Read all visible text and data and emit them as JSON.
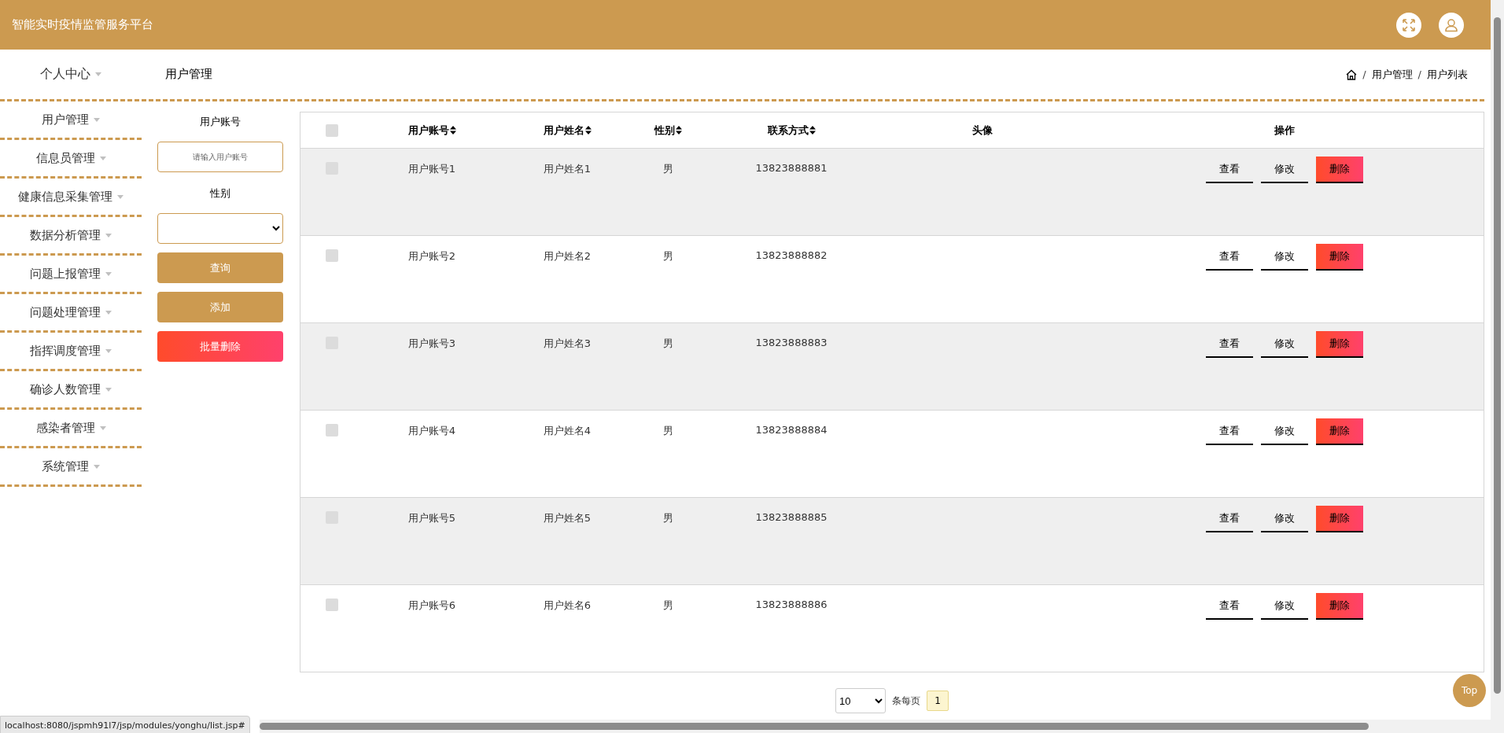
{
  "header": {
    "title": "智能实时疫情监管服务平台"
  },
  "sidebar": {
    "items": [
      {
        "label": "个人中心"
      },
      {
        "label": "用户管理"
      },
      {
        "label": "信息员管理"
      },
      {
        "label": "健康信息采集管理"
      },
      {
        "label": "数据分析管理"
      },
      {
        "label": "问题上报管理"
      },
      {
        "label": "问题处理管理"
      },
      {
        "label": "指挥调度管理"
      },
      {
        "label": "确诊人数管理"
      },
      {
        "label": "感染者管理"
      },
      {
        "label": "系统管理"
      }
    ]
  },
  "page_title": "用户管理",
  "breadcrumb": [
    {
      "kind": "separator",
      "label": "/"
    },
    {
      "kind": "item",
      "label": "用户管理"
    },
    {
      "kind": "separator",
      "label": "/"
    },
    {
      "kind": "item",
      "label": "用户列表"
    }
  ],
  "filters": {
    "fields": [
      {
        "kind": "input",
        "label": "用户账号",
        "placeholder": "请输入用户账号"
      },
      {
        "kind": "select",
        "label": "性别"
      }
    ],
    "buttons": [
      {
        "kind": "primary",
        "label": "查询"
      },
      {
        "kind": "primary",
        "label": "添加"
      },
      {
        "kind": "danger",
        "label": "批量删除"
      }
    ]
  },
  "table": {
    "all_checked": false,
    "columns": [
      {
        "label": "用户账号",
        "sortable": true
      },
      {
        "label": "用户姓名",
        "sortable": true
      },
      {
        "label": "性别",
        "sortable": true
      },
      {
        "label": "联系方式",
        "sortable": true
      },
      {
        "label": "头像",
        "sortable": false
      },
      {
        "label": "操作",
        "sortable": false
      }
    ],
    "rows": [
      {
        "checked": false,
        "cells": [
          "用户账号1",
          "用户姓名1",
          "男",
          "13823888881"
        ],
        "actions": [
          {
            "kind": "plain",
            "label": "查看"
          },
          {
            "kind": "plain",
            "label": "修改"
          },
          {
            "kind": "danger",
            "label": "删除"
          }
        ]
      },
      {
        "checked": false,
        "cells": [
          "用户账号2",
          "用户姓名2",
          "男",
          "13823888882"
        ],
        "actions": [
          {
            "kind": "plain",
            "label": "查看"
          },
          {
            "kind": "plain",
            "label": "修改"
          },
          {
            "kind": "danger",
            "label": "删除"
          }
        ]
      },
      {
        "checked": false,
        "cells": [
          "用户账号3",
          "用户姓名3",
          "男",
          "13823888883"
        ],
        "actions": [
          {
            "kind": "plain",
            "label": "查看"
          },
          {
            "kind": "plain",
            "label": "修改"
          },
          {
            "kind": "danger",
            "label": "删除"
          }
        ]
      },
      {
        "checked": false,
        "cells": [
          "用户账号4",
          "用户姓名4",
          "男",
          "13823888884"
        ],
        "actions": [
          {
            "kind": "plain",
            "label": "查看"
          },
          {
            "kind": "plain",
            "label": "修改"
          },
          {
            "kind": "danger",
            "label": "删除"
          }
        ]
      },
      {
        "checked": false,
        "cells": [
          "用户账号5",
          "用户姓名5",
          "男",
          "13823888885"
        ],
        "actions": [
          {
            "kind": "plain",
            "label": "查看"
          },
          {
            "kind": "plain",
            "label": "修改"
          },
          {
            "kind": "danger",
            "label": "删除"
          }
        ]
      },
      {
        "checked": false,
        "cells": [
          "用户账号6",
          "用户姓名6",
          "男",
          "13823888886"
        ],
        "actions": [
          {
            "kind": "plain",
            "label": "查看"
          },
          {
            "kind": "plain",
            "label": "修改"
          },
          {
            "kind": "danger",
            "label": "删除"
          }
        ]
      }
    ]
  },
  "pagination": {
    "page_size": "10",
    "page_size_label": "条每页",
    "pages": [
      {
        "label": "1",
        "selected": true
      }
    ]
  },
  "back_to_top": "Top",
  "status_bar": "localhost:8080/jspmh91l7/jsp/modules/yonghu/list.jsp#"
}
